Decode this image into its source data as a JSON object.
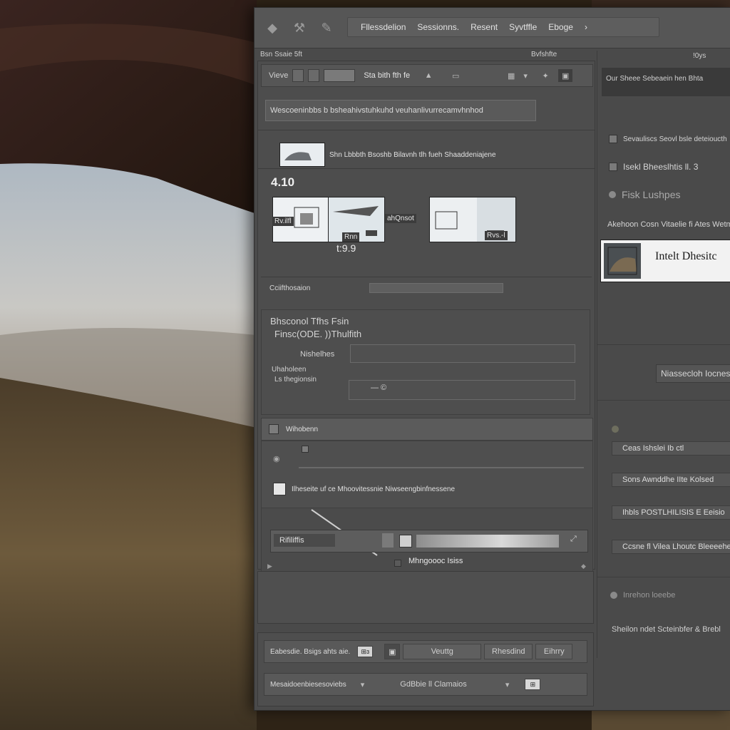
{
  "toolbar": {
    "menu_items": [
      "Fllessdelion",
      "Sessionns.",
      "Resent",
      "Syvtffle",
      "Eboge"
    ],
    "chevron": "›"
  },
  "center_panel": {
    "title_left": "Bsn Ssaie 5ft",
    "title_right": "Bvfshfte",
    "subbar_label": "Vieve",
    "subbar_title": "Sta bith fth fe",
    "path": "Wescoeninbbs b bsheahivstuhkuhd veuhanlivurrecamvhnhod",
    "layer_label": "Shn Lbbbth Bsoshb Bilavnh tlh fueh Shaaddeniajene",
    "frame_number_big": "4.10",
    "frame_number_mid": "t:9.9",
    "frame_labels": [
      "Rv.ilfl",
      "Rnn",
      "ahQnsot",
      "Rvs.-l"
    ],
    "status_label": "Cciifthosaion",
    "properties": {
      "heading_1": "Bhsconol Tfhs Fsin",
      "heading_2": "Finsc(ODE. ))Thulfith",
      "key_1": "Nishelhes",
      "key_2": "Uhaholeen",
      "key_3": "Ls thegionsin",
      "field_value": "— ©"
    },
    "section_title": "Wihobenn",
    "checkbox_label": "Ilheseite uf ce Mhoovitessnie Niwseengbinfnessene",
    "timeline": {
      "left_label": "Rifiliffis",
      "caption": "Mhngoooc Isiss"
    },
    "footer": {
      "row1_label": "Eabesdie. Bsigs ahts aie.",
      "row1_chip": "⊞ɜ",
      "row1_btn1": "Veuttg",
      "row1_btn2": "Rhesdind",
      "row1_btn3": "Eihrry",
      "row2_label": "Mesaidoenbiesesoviebs",
      "row2_mid": "GdBbie ll Clamaios",
      "row2_chip": "⊞"
    }
  },
  "right_panel": {
    "top_label": "!0ys",
    "header_text": "Our Sheee   Sebeaein hen Bhta",
    "items": [
      "Sevauliscs Seovl bsle deteioucth",
      "Isekl Bheeslhtis ll. 3",
      "Fisk Lushpes",
      "Akehoon Cosn Vitaelie fi Ates Wetms"
    ],
    "card_title": "Intelt Dhesitc",
    "button_label": "Niassecloh Iocnesi",
    "list": [
      "Ceas Ishslei Ib ctl",
      "Sons Awnddhe IIte Kolsed",
      "Ihbls POSTLHILISIS E Eeisio",
      "Ccsne fl Vilea Lhoutc Bleeeehesi"
    ],
    "bottom_item": "Inrehon loeebe",
    "bottom_text": "Sheilon ndet Scteinbfer & Brebl"
  },
  "colors": {
    "window_bg": "#4a4a4a",
    "toolbar_bg": "#565656",
    "card_bg": "#f2f2f2"
  }
}
